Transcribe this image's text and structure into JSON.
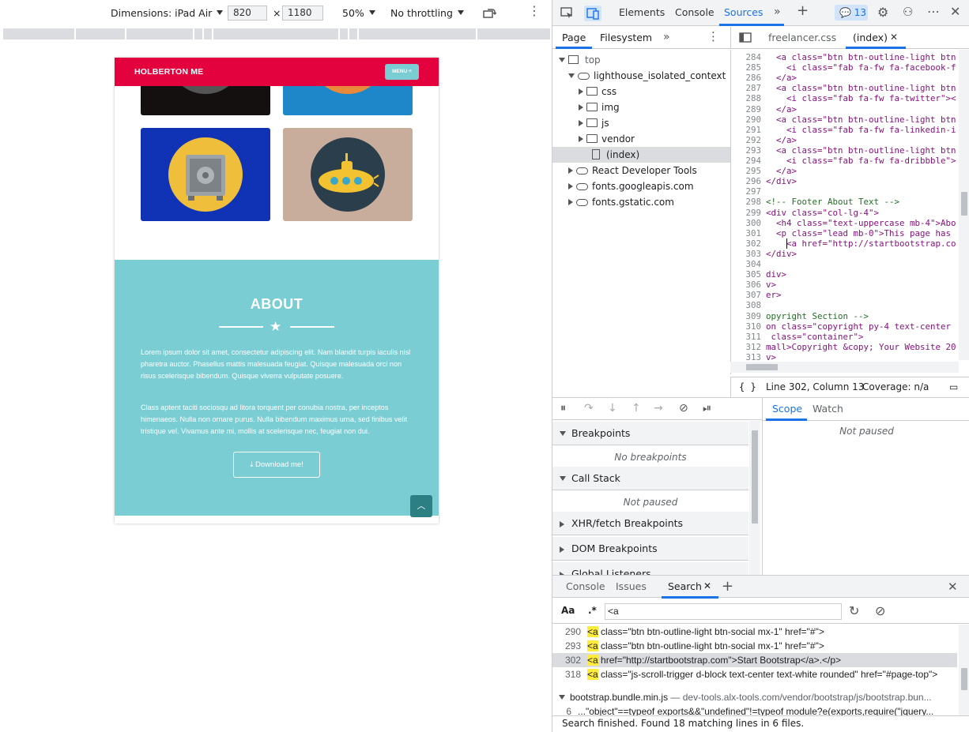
{
  "device_toolbar": {
    "dimensions_label": "Dimensions: iPad Air",
    "width_value": "820",
    "times": "×",
    "height_value": "1180",
    "zoom": "50%",
    "throttling": "No throttling"
  },
  "site": {
    "brand": "HOLBERTON ME",
    "menu_label": "MENU",
    "about_title": "ABOUT",
    "about_p1": "Lorem ipsum dolor sit amet, consectetur adipiscing elit. Nam blandit turpis iaculis nisl pharetra auctor. Phasellus mattis malesuada feugiat. Quisque malesuada orci non risus scelerisque bibendum. Quisque viverra vulputate posuere.",
    "about_p2": "Class aptent taciti sociosqu ad litora torquent per conubia nostra, per inceptos himenaeos. Nulla non ornare purus. Nulla bibendum maximus urna, sed finibus velit tristique vel. Vivamus ante mi, mollis at scelerisque nec, feugiat non dui.",
    "download_label": "Download me!",
    "colors": {
      "nav": "#e3023d",
      "about_bg": "#79cdd3",
      "tile_blue": "#1032b4",
      "tile_beige": "#c8ad9d"
    }
  },
  "devtools": {
    "tabs": [
      "Elements",
      "Console",
      "Sources"
    ],
    "active_tab": "Sources",
    "issues_count": "13",
    "navigator_tabs": [
      "Page",
      "Filesystem"
    ],
    "tree": [
      {
        "label": "top"
      },
      {
        "label": "lighthouse_isolated_context"
      },
      {
        "label": "css"
      },
      {
        "label": "img"
      },
      {
        "label": "js"
      },
      {
        "label": "vendor"
      },
      {
        "label": "(index)"
      },
      {
        "label": "React Developer Tools"
      },
      {
        "label": "fonts.googleapis.com"
      },
      {
        "label": "fonts.gstatic.com"
      }
    ],
    "editor_tabs": [
      "freelancer.css",
      "(index)"
    ],
    "code_lines": [
      {
        "n": "284",
        "t": "  <a class=\"btn btn-outline-light btn"
      },
      {
        "n": "285",
        "t": "    <i class=\"fab fa-fw fa-facebook-f"
      },
      {
        "n": "286",
        "t": "  </a>"
      },
      {
        "n": "287",
        "t": "  <a class=\"btn btn-outline-light btn"
      },
      {
        "n": "288",
        "t": "    <i class=\"fab fa-fw fa-twitter\"><"
      },
      {
        "n": "289",
        "t": "  </a>"
      },
      {
        "n": "290",
        "t": "  <a class=\"btn btn-outline-light btn"
      },
      {
        "n": "291",
        "t": "    <i class=\"fab fa-fw fa-linkedin-i"
      },
      {
        "n": "292",
        "t": "  </a>"
      },
      {
        "n": "293",
        "t": "  <a class=\"btn btn-outline-light btn"
      },
      {
        "n": "294",
        "t": "    <i class=\"fab fa-fw fa-dribbble\">"
      },
      {
        "n": "295",
        "t": "  </a>"
      },
      {
        "n": "296",
        "t": "</div>"
      },
      {
        "n": "297",
        "t": ""
      },
      {
        "n": "298",
        "t": "<!-- Footer About Text -->"
      },
      {
        "n": "299",
        "t": "<div class=\"col-lg-4\">"
      },
      {
        "n": "300",
        "t": "  <h4 class=\"text-uppercase mb-4\">Abo"
      },
      {
        "n": "301",
        "t": "  <p class=\"lead mb-0\">This page has"
      },
      {
        "n": "302",
        "t": "    <a href=\"http://startbootstrap.co"
      },
      {
        "n": "303",
        "t": "</div>"
      },
      {
        "n": "304",
        "t": ""
      },
      {
        "n": "305",
        "t": "div>"
      },
      {
        "n": "306",
        "t": "v>"
      },
      {
        "n": "307",
        "t": "er>"
      },
      {
        "n": "308",
        "t": ""
      },
      {
        "n": "309",
        "t": "opyright Section -->"
      },
      {
        "n": "310",
        "t": "on class=\"copyright py-4 text-center"
      },
      {
        "n": "311",
        "t": " class=\"container\">"
      },
      {
        "n": "312",
        "t": "mall>Copyright &copy; Your Website 20"
      },
      {
        "n": "313",
        "t": "v>"
      }
    ],
    "cursor_pos": "Line 302, Column 13",
    "coverage": "Coverage: n/a",
    "sections": {
      "breakpoints": "Breakpoints",
      "no_breakpoints": "No breakpoints",
      "call_stack": "Call Stack",
      "not_paused": "Not paused",
      "xhr": "XHR/fetch Breakpoints",
      "dom": "DOM Breakpoints",
      "global": "Global Listeners"
    },
    "scope_tabs": [
      "Scope",
      "Watch"
    ],
    "scope_status": "Not paused",
    "drawer_tabs": [
      "Console",
      "Issues",
      "Search"
    ],
    "search": {
      "case_label": "Aa",
      "regex_label": ".*",
      "query": "<a",
      "results": [
        {
          "n": "290",
          "m": "<a",
          "rest": " class=\"btn btn-outline-light btn-social mx-1\" href=\"#\">"
        },
        {
          "n": "293",
          "m": "<a",
          "rest": " class=\"btn btn-outline-light btn-social mx-1\" href=\"#\">"
        },
        {
          "n": "302",
          "m": "<a",
          "rest": " href=\"http://startbootstrap.com\">Start Bootstrap</a>.</p>"
        },
        {
          "n": "318",
          "m": "<a",
          "rest": " class=\"js-scroll-trigger d-block text-center text-white rounded\" href=\"#page-top\">"
        }
      ],
      "file2_name": "bootstrap.bundle.min.js",
      "file2_path": "— dev-tools.alx-tools.com/vendor/bootstrap/js/bootstrap.bun...",
      "file2_line_n": "6",
      "file2_line": "...\"object\"==typeof exports&&\"undefined\"!=typeof module?e(exports,require(\"jquery...",
      "status": "Search finished.  Found 18 matching lines in 6 files."
    }
  }
}
